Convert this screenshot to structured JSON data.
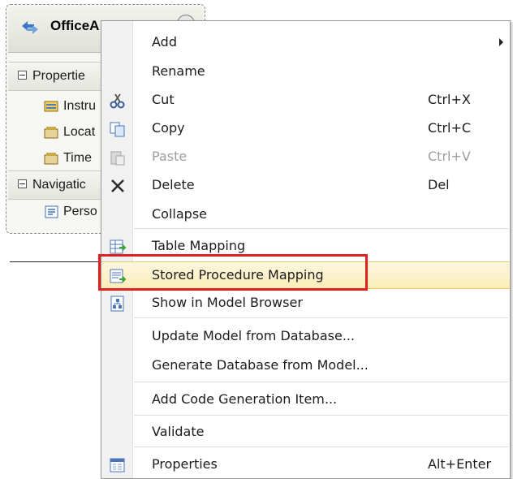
{
  "entity": {
    "title": "OfficeA",
    "sections": {
      "properties": "Propertie",
      "navigation": "Navigatic"
    },
    "properties": [
      "Instru",
      "Locat",
      "Time"
    ],
    "navigation_properties": [
      "Perso"
    ]
  },
  "menu": {
    "add": "Add",
    "rename": "Rename",
    "cut": "Cut",
    "cut_shortcut": "Ctrl+X",
    "copy": "Copy",
    "copy_shortcut": "Ctrl+C",
    "paste": "Paste",
    "paste_shortcut": "Ctrl+V",
    "delete": "Delete",
    "delete_shortcut": "Del",
    "collapse": "Collapse",
    "table_mapping": "Table Mapping",
    "stored_procedure_mapping": "Stored Procedure Mapping",
    "show_in_model_browser": "Show in Model Browser",
    "update_model": "Update Model from Database...",
    "generate_database": "Generate Database from Model...",
    "add_code_generation": "Add Code Generation Item...",
    "validate": "Validate",
    "properties": "Properties",
    "properties_shortcut": "Alt+Enter"
  },
  "colors": {
    "highlight": "#fbeeb8",
    "redbox": "#e02020"
  }
}
